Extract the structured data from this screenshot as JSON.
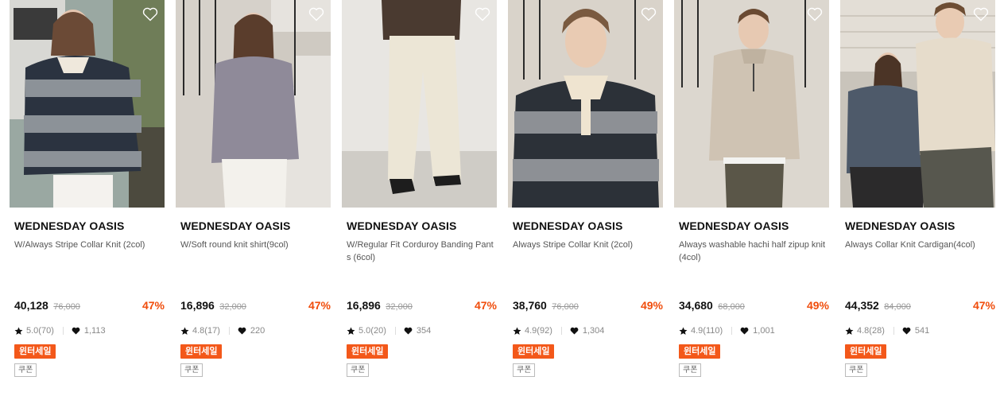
{
  "products": [
    {
      "brand": "WEDNESDAY OASIS",
      "name": "W/Always Stripe Collar Knit (2col)",
      "price": "40,128",
      "original_price": "76,000",
      "discount": "47%",
      "rating": "5.0(70)",
      "likes": "1,113",
      "badge": "윈터세일",
      "coupon": "쿠폰",
      "image_icon": "model-photo-stripe-knit"
    },
    {
      "brand": "WEDNESDAY OASIS",
      "name": "W/Soft round knit shirt(9col)",
      "price": "16,896",
      "original_price": "32,000",
      "discount": "47%",
      "rating": "4.8(17)",
      "likes": "220",
      "badge": "윈터세일",
      "coupon": "쿠폰",
      "image_icon": "model-photo-grey-knit"
    },
    {
      "brand": "WEDNESDAY OASIS",
      "name": "W/Regular Fit Corduroy Banding Pants (6col)",
      "price": "16,896",
      "original_price": "32,000",
      "discount": "47%",
      "rating": "5.0(20)",
      "likes": "354",
      "badge": "윈터세일",
      "coupon": "쿠폰",
      "image_icon": "model-photo-cream-pants"
    },
    {
      "brand": "WEDNESDAY OASIS",
      "name": "Always Stripe Collar Knit (2col)",
      "price": "38,760",
      "original_price": "76,000",
      "discount": "49%",
      "rating": "4.9(92)",
      "likes": "1,304",
      "badge": "윈터세일",
      "coupon": "쿠폰",
      "image_icon": "model-photo-stripe-knit-men"
    },
    {
      "brand": "WEDNESDAY OASIS",
      "name": "Always washable hachi half zipup knit(4col)",
      "price": "34,680",
      "original_price": "68,000",
      "discount": "49%",
      "rating": "4.9(110)",
      "likes": "1,001",
      "badge": "윈터세일",
      "coupon": "쿠폰",
      "image_icon": "model-photo-half-zip"
    },
    {
      "brand": "WEDNESDAY OASIS",
      "name": "Always Collar Knit Cardigan(4col)",
      "price": "44,352",
      "original_price": "84,000",
      "discount": "47%",
      "rating": "4.8(28)",
      "likes": "541",
      "badge": "윈터세일",
      "coupon": "쿠폰",
      "image_icon": "model-photo-cardigan-couple"
    }
  ],
  "colors": {
    "discount": "#f04d0c",
    "badge_bg": "#f3581a",
    "text_dark": "#111111",
    "text_muted": "#888888"
  }
}
